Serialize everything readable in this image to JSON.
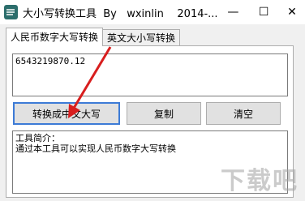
{
  "window": {
    "title": "大小写转换工具  By   wxinlin    2014-...",
    "minimize": "—",
    "maximize": "☐",
    "close": "✕",
    "icon": "app-logo-icon"
  },
  "tabs": [
    {
      "label": "人民币数字大写转换",
      "active": true
    },
    {
      "label": "英文大小写转换",
      "active": false
    }
  ],
  "input": {
    "value": "6543219870.12"
  },
  "buttons": {
    "convert": "转换成中文大写",
    "copy": "复制",
    "clear": "清空"
  },
  "info": {
    "text": "工具简介：\n通过本工具可以实现人民币数字大写转换"
  },
  "watermark": {
    "text": "下载吧"
  },
  "colors": {
    "accent": "#3d7bd6",
    "arrow": "#d81e1e"
  }
}
